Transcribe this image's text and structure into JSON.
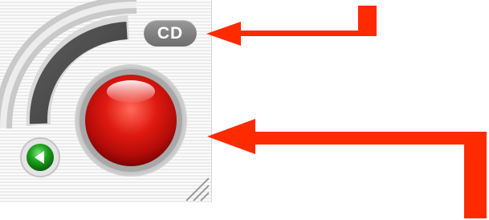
{
  "window": {
    "cd_badge_label": "CD"
  },
  "icons": {
    "record_button": "record-button-icon",
    "back_arrow": "back-arrow-icon",
    "level_meter": "level-meter-arc-icon",
    "resize_grip": "resize-grip-icon"
  },
  "colors": {
    "annotation_arrow": "#ff2a00",
    "record_red": "#cc1010",
    "back_green": "#1e9a1e",
    "badge_gray": "#8a8a8a",
    "meter_dark": "#4a4a4a"
  }
}
